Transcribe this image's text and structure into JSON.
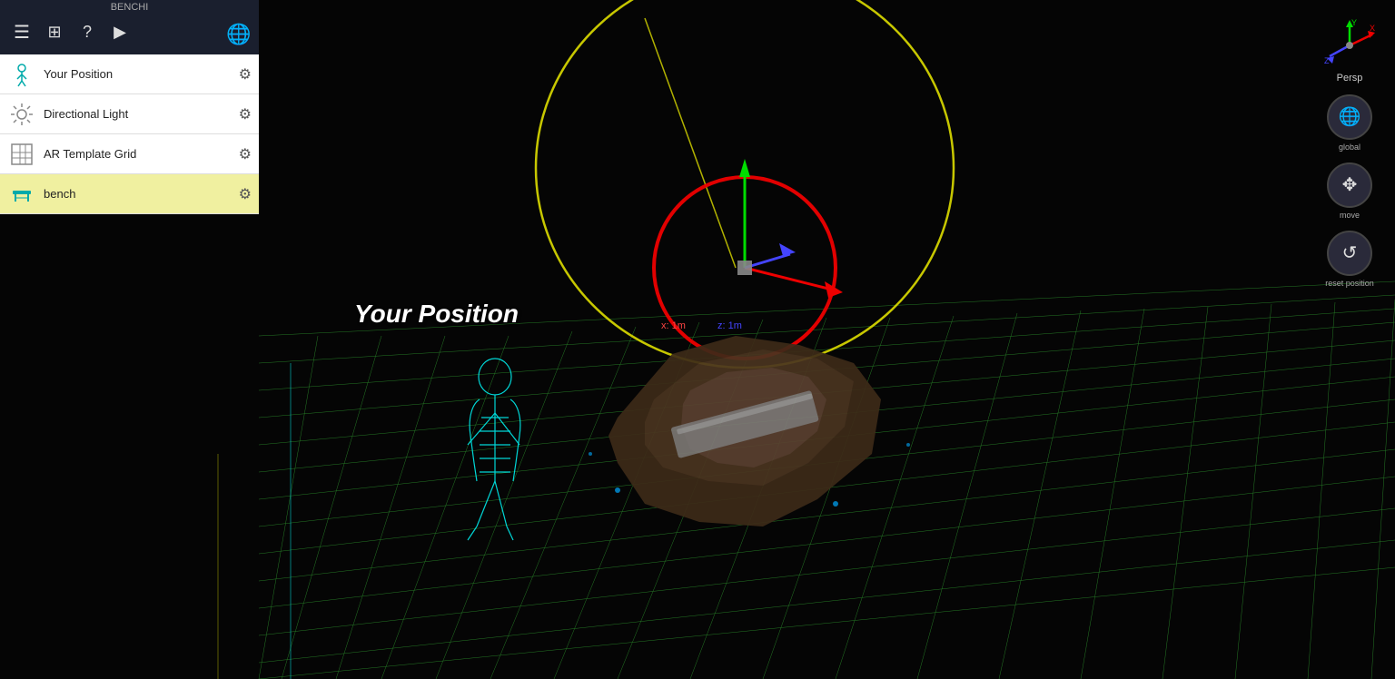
{
  "app": {
    "title": "BENCHI"
  },
  "top_bar": {
    "icons": [
      "menu",
      "add",
      "help",
      "play",
      "globe"
    ]
  },
  "sidebar": {
    "items": [
      {
        "id": "your-position",
        "label": "Your Position",
        "icon": "person",
        "active": false
      },
      {
        "id": "directional-light",
        "label": "Directional Light",
        "icon": "sun",
        "active": false
      },
      {
        "id": "ar-template-grid",
        "label": "AR Template Grid",
        "icon": "grid",
        "active": false
      },
      {
        "id": "bench",
        "label": "bench",
        "icon": "bench",
        "active": true
      }
    ]
  },
  "right_controls": {
    "persp_label": "Persp",
    "global_label": "global",
    "move_label": "move",
    "reset_label": "reset position"
  },
  "scene": {
    "your_position_label": "Your Position",
    "coord_x": "x: 1m",
    "coord_z": "z: 1m"
  }
}
